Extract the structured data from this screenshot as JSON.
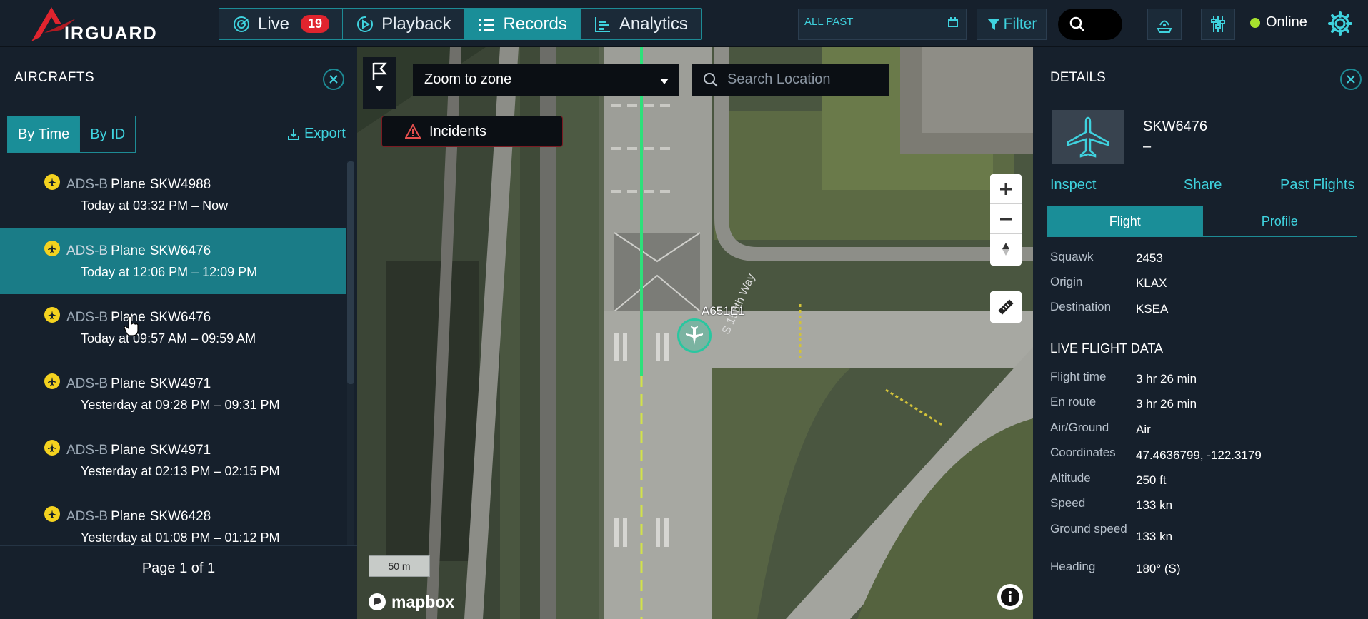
{
  "brand": {
    "name": "IRGUARD"
  },
  "nav": {
    "tabs": [
      {
        "label": "Live",
        "badge": "19"
      },
      {
        "label": "Playback"
      },
      {
        "label": "Records"
      },
      {
        "label": "Analytics"
      }
    ]
  },
  "toolbar": {
    "date_range": "ALL PAST",
    "filter_label": "Filter",
    "status_label": "Online"
  },
  "aircrafts": {
    "title": "AIRCRAFTS",
    "sort_options": [
      "By Time",
      "By ID"
    ],
    "export_label": "Export",
    "items": [
      {
        "source": "ADS-B",
        "kind": "Plane",
        "id": "SKW4988",
        "time": "Today at 03:32 PM – Now"
      },
      {
        "source": "ADS-B",
        "kind": "Plane",
        "id": "SKW6476",
        "time": "Today at 12:06 PM – 12:09 PM"
      },
      {
        "source": "ADS-B",
        "kind": "Plane",
        "id": "SKW6476",
        "time": "Today at 09:57 AM – 09:59 AM"
      },
      {
        "source": "ADS-B",
        "kind": "Plane",
        "id": "SKW4971",
        "time": "Yesterday at 09:28 PM – 09:31 PM"
      },
      {
        "source": "ADS-B",
        "kind": "Plane",
        "id": "SKW4971",
        "time": "Yesterday at 02:13 PM – 02:15 PM"
      },
      {
        "source": "ADS-B",
        "kind": "Plane",
        "id": "SKW6428",
        "time": "Yesterday at 01:08 PM – 01:12 PM"
      }
    ],
    "pager": "Page 1 of 1"
  },
  "map": {
    "zoom_select": "Zoom to zone",
    "search_placeholder": "Search Location",
    "incidents_label": "Incidents",
    "scale_label": "50 m",
    "attribution": "mapbox",
    "track_label": "A651E1",
    "road_label": "S 156th Way"
  },
  "details": {
    "title": "DETAILS",
    "aircraft_id": "SKW6476",
    "aircraft_sub": "–",
    "links": {
      "inspect": "Inspect",
      "share": "Share",
      "past_flights": "Past Flights"
    },
    "tabs": [
      "Flight",
      "Profile"
    ],
    "flight": [
      {
        "key": "Squawk",
        "value": "2453"
      },
      {
        "key": "Origin",
        "value": "KLAX"
      },
      {
        "key": "Destination",
        "value": "KSEA"
      }
    ],
    "live_title": "LIVE FLIGHT DATA",
    "live": [
      {
        "key": "Flight time",
        "value": "3 hr 26 min"
      },
      {
        "key": "En route",
        "value": "3 hr 26 min"
      },
      {
        "key": "Air/Ground",
        "value": "Air"
      },
      {
        "key": "Coordinates",
        "value": "47.4636799, -122.3179"
      },
      {
        "key": "Altitude",
        "value": "250 ft"
      },
      {
        "key": "Speed",
        "value": "133 kn"
      },
      {
        "key": "Ground speed",
        "value": "133 kn"
      },
      {
        "key": "Heading",
        "value": "180° (S)"
      }
    ]
  }
}
